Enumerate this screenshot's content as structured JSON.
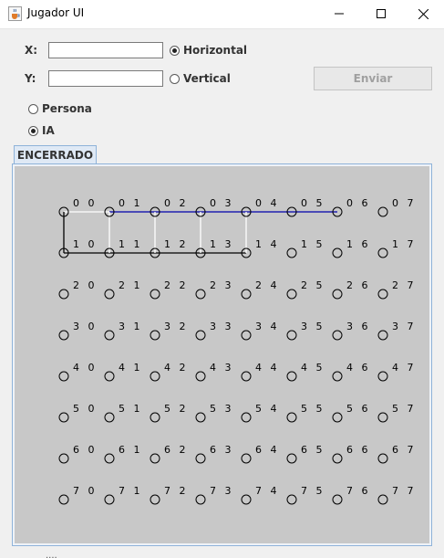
{
  "window": {
    "title": "Jugador UI",
    "icon": "java-cup-icon"
  },
  "form": {
    "x_label": "X:",
    "y_label": "Y:",
    "x_value": "",
    "y_value": "",
    "horizontal_label": "Horizontal",
    "vertical_label": "Vertical",
    "orientation_selected": "Horizontal",
    "persona_label": "Persona",
    "ia_label": "IA",
    "player_selected": "IA",
    "send_label": "Enviar",
    "send_enabled": false
  },
  "tab": {
    "label": "ENCERRADO"
  },
  "board": {
    "rows": 8,
    "cols": 8,
    "lines": [
      {
        "from": "00",
        "to": "01",
        "color": "#ffffff"
      },
      {
        "from": "01",
        "to": "02",
        "color": "#0000aa"
      },
      {
        "from": "02",
        "to": "03",
        "color": "#0000aa"
      },
      {
        "from": "03",
        "to": "04",
        "color": "#0000aa"
      },
      {
        "from": "04",
        "to": "05",
        "color": "#0000aa"
      },
      {
        "from": "05",
        "to": "06",
        "color": "#0000aa"
      },
      {
        "from": "00",
        "to": "10",
        "color": "#000000"
      },
      {
        "from": "10",
        "to": "11",
        "color": "#000000"
      },
      {
        "from": "11",
        "to": "12",
        "color": "#000000"
      },
      {
        "from": "12",
        "to": "13",
        "color": "#000000"
      },
      {
        "from": "13",
        "to": "14",
        "color": "#000000"
      },
      {
        "from": "01",
        "to": "11",
        "color": "#ffffff"
      },
      {
        "from": "02",
        "to": "12",
        "color": "#ffffff"
      },
      {
        "from": "03",
        "to": "13",
        "color": "#ffffff"
      },
      {
        "from": "04",
        "to": "14",
        "color": "#ffffff"
      }
    ]
  },
  "footer": {
    "partial_text": "...."
  }
}
